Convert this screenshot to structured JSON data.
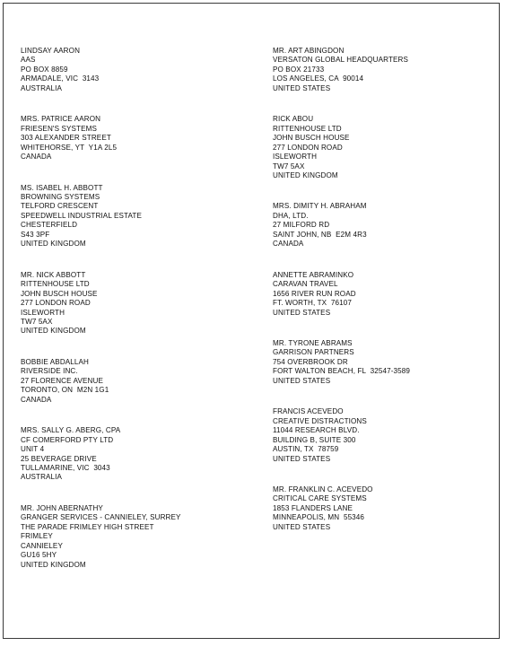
{
  "document": {
    "type": "address-list-page",
    "background_color": "#ffffff",
    "border_color": "#3a3a3a",
    "text_color": "#111111",
    "columns": [
      {
        "name": "left-column",
        "blocks": [
          {
            "name": "lindsay-aaron",
            "lines": [
              "LINDSAY AARON",
              "AAS",
              "PO BOX 8859",
              "ARMADALE, VIC  3143",
              "AUSTRALIA"
            ]
          },
          {
            "name": "patrice-aaron",
            "lines": [
              "MRS. PATRICE AARON",
              "FRIESEN'S SYSTEMS",
              "303 ALEXANDER STREET",
              "WHITEHORSE, YT  Y1A 2L5",
              "CANADA"
            ]
          },
          {
            "name": "isabel-h-abbott",
            "lines": [
              "MS. ISABEL H. ABBOTT",
              "BROWNING SYSTEMS",
              "TELFORD CRESCENT",
              "SPEEDWELL INDUSTRIAL ESTATE",
              "CHESTERFIELD",
              "S43 3PF",
              "UNITED KINGDOM"
            ]
          },
          {
            "name": "nick-abbott",
            "lines": [
              "MR. NICK ABBOTT",
              "RITTENHOUSE LTD",
              "JOHN BUSCH HOUSE",
              "277 LONDON ROAD",
              "ISLEWORTH",
              "TW7 5AX",
              "UNITED KINGDOM"
            ]
          },
          {
            "name": "bobbie-abdallah",
            "lines": [
              "BOBBIE ABDALLAH",
              "RIVERSIDE INC.",
              "27 FLORENCE AVENUE",
              "TORONTO, ON  M2N 1G1",
              "CANADA"
            ]
          },
          {
            "name": "sally-g-aberg",
            "lines": [
              "MRS. SALLY G. ABERG, CPA",
              "CF COMERFORD PTY LTD",
              "UNIT 4",
              "25 BEVERAGE DRIVE",
              "TULLAMARINE, VIC  3043",
              "AUSTRALIA"
            ]
          },
          {
            "name": "john-abernathy",
            "lines": [
              "MR. JOHN ABERNATHY",
              "GRANGER SERVICES - CANNIELEY, SURREY",
              "THE PARADE FRIMLEY HIGH STREET",
              "FRIMLEY",
              "CANNIELEY",
              "GU16 5HY",
              "UNITED KINGDOM"
            ]
          }
        ]
      },
      {
        "name": "right-column",
        "blocks": [
          {
            "name": "art-abingdon",
            "lines": [
              "MR. ART ABINGDON",
              "VERSATON GLOBAL HEADQUARTERS",
              "PO BOX 21733",
              "LOS ANGELES, CA  90014",
              "UNITED STATES"
            ]
          },
          {
            "name": "rick-abou",
            "lines": [
              "RICK ABOU",
              "RITTENHOUSE LTD",
              "JOHN BUSCH HOUSE",
              "277 LONDON ROAD",
              "ISLEWORTH",
              "TW7 5AX",
              "UNITED KINGDOM"
            ]
          },
          {
            "name": "dimity-h-abraham",
            "lines": [
              "MRS. DIMITY H. ABRAHAM",
              "DHA, LTD.",
              "27 MILFORD RD",
              "SAINT JOHN, NB  E2M 4R3",
              "CANADA"
            ]
          },
          {
            "name": "annette-abraminko",
            "lines": [
              "ANNETTE ABRAMINKO",
              "CARAVAN TRAVEL",
              "1656 RIVER RUN ROAD",
              "FT. WORTH, TX  76107",
              "UNITED STATES"
            ]
          },
          {
            "name": "tyrone-abrams",
            "lines": [
              "MR. TYRONE ABRAMS",
              "GARRISON PARTNERS",
              "754 OVERBROOK DR",
              "FORT WALTON BEACH, FL  32547-3589",
              "UNITED STATES"
            ]
          },
          {
            "name": "francis-acevedo",
            "lines": [
              "FRANCIS ACEVEDO",
              "CREATIVE DISTRACTIONS",
              "11044 RESEARCH BLVD.",
              "BUILDING B, SUITE 300",
              "AUSTIN, TX  78759",
              "UNITED STATES"
            ]
          },
          {
            "name": "franklin-c-acevedo",
            "lines": [
              "MR. FRANKLIN C. ACEVEDO",
              "CRITICAL CARE SYSTEMS",
              "1853 FLANDERS LANE",
              "MINNEAPOLIS, MN  55346",
              "UNITED STATES"
            ]
          }
        ]
      }
    ]
  }
}
